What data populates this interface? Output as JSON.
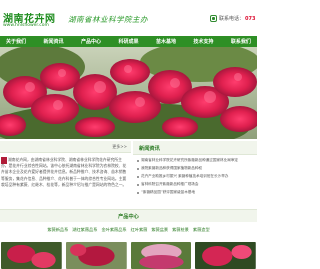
{
  "header": {
    "site_title": "湖南花卉网",
    "site_url": "www.hnlsflower.com",
    "slogan": "湖南省林业科学院主办",
    "hotline_label": "联系电话：",
    "hotline_number": "073"
  },
  "nav": {
    "items": [
      "关于我们",
      "新闻资讯",
      "产品中心",
      "科研成果",
      "苗木基地",
      "技术支持",
      "联系我们"
    ]
  },
  "intro": {
    "more_label": "更多>>",
    "text": "湖南花卉网，由湖南省林业科学院、湖南省林业科学院花卉研究所主办，是花卉行业综合性网站。该中心依托湖南省林业科学院为农林院校、花卉苗木企业及花卉爱好者提供花卉信息。新品种推介、技术咨询、苗木销售等服务，集花卉信息、品种推介、花卉科普于一体的综合性专业网站。主要栽培品种有紫薇、红继木、桂花等，新品种介绍与推广是网站的特色之一。"
  },
  "news": {
    "title": "新闻资讯",
    "items": [
      "湖南省林业科学院花卉研究所紫薇新品种通过国家林业局审定",
      "我院紫薇新品种获得国家植物新品种权",
      "花卉产业助推乡村振兴 紫薇种植技术培训班在长沙举办",
      "省林科院召开紫薇新品种推广现场会",
      "“紫薇精品园”获评国家级苗木基地"
    ]
  },
  "products": {
    "title": "产品中心",
    "categories": [
      "紫薇新品系",
      "湖红紫薇品系",
      "金叶紫薇品系",
      "红叶紫薇",
      "紫薇盆景",
      "紫薇桩景",
      "紫薇造型"
    ]
  }
}
